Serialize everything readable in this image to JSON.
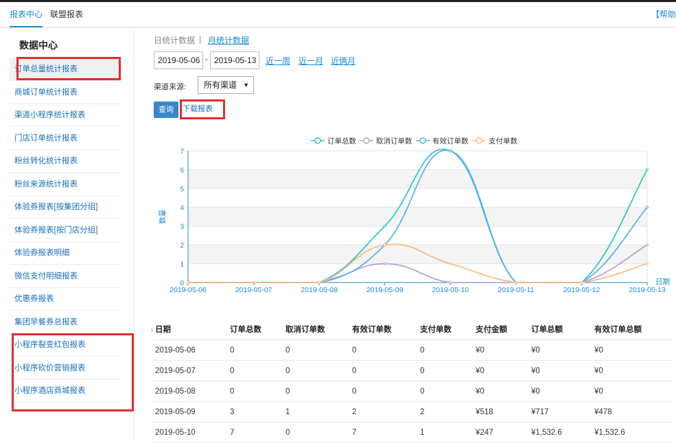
{
  "topnav": {
    "tab1": "报表中心",
    "tab2": "联盟报表",
    "help": "【帮助"
  },
  "sidebar": {
    "title": "数据中心",
    "items": [
      {
        "label": "订单总量统计报表"
      },
      {
        "label": "商城订单统计报表"
      },
      {
        "label": "渠道小程序统计报表"
      },
      {
        "label": "门店订单统计报表"
      },
      {
        "label": "粉丝转化统计报表"
      },
      {
        "label": "粉丝来源统计报表"
      },
      {
        "label": "体验券报表[按集团分组]"
      },
      {
        "label": "体验券报表[按门店分组]"
      },
      {
        "label": "体验券报表明细"
      },
      {
        "label": "微信支付明细报表"
      },
      {
        "label": "优惠券报表"
      },
      {
        "label": "集团早餐券总报表"
      },
      {
        "label": "小程序裂变红包报表"
      },
      {
        "label": "小程序砍价营销报表"
      },
      {
        "label": "小程序酒店商城报表"
      }
    ]
  },
  "filters": {
    "daily_tab": "日统计数据",
    "separator": "|",
    "monthly_tab": "月统计数据",
    "start_date": "2019-05-06",
    "date_dash": "-",
    "end_date": "2019-05-13",
    "quick_week": "近一周",
    "quick_month": "近一月",
    "quick_two_months": "近俩月",
    "channel_label": "渠道来源:",
    "channel_value": "所有渠道",
    "query_button": "查询",
    "download_button": "下载报表"
  },
  "chart_data": {
    "type": "line",
    "categories": [
      "2019-05-06",
      "2019-05-07",
      "2019-05-08",
      "2019-05-09",
      "2019-05-10",
      "2019-05-11",
      "2019-05-12",
      "2019-05-13"
    ],
    "xlabel": "日期",
    "ylabel": "数量",
    "ylim": [
      0,
      7
    ],
    "yticks": [
      "0",
      "1",
      "2",
      "3",
      "4",
      "5",
      "6",
      "7"
    ],
    "legend_position": "top",
    "series": [
      {
        "name": "订单总数",
        "color": "#2ec7c9",
        "values": [
          0,
          0,
          0,
          3,
          7,
          0,
          0,
          6
        ]
      },
      {
        "name": "取消订单数",
        "color": "#b6a2de",
        "values": [
          0,
          0,
          0,
          1,
          0,
          0,
          0,
          2
        ]
      },
      {
        "name": "有效订单数",
        "color": "#5ab1ef",
        "values": [
          0,
          0,
          0,
          2,
          7,
          0,
          0,
          4
        ]
      },
      {
        "name": "支付单数",
        "color": "#ffb980",
        "values": [
          0,
          0,
          0,
          2,
          1,
          0,
          0,
          1
        ]
      }
    ]
  },
  "table": {
    "headers": [
      "日期",
      "订单总数",
      "取消订单数",
      "有效订单数",
      "支付单数",
      "支付金额",
      "订单总额",
      "有效订单总额"
    ],
    "rows": [
      [
        "2019-05-06",
        "0",
        "0",
        "0",
        "0",
        "¥0",
        "¥0",
        "¥0"
      ],
      [
        "2019-05-07",
        "0",
        "0",
        "0",
        "0",
        "¥0",
        "¥0",
        "¥0"
      ],
      [
        "2019-05-08",
        "0",
        "0",
        "0",
        "0",
        "¥0",
        "¥0",
        "¥0"
      ],
      [
        "2019-05-09",
        "3",
        "1",
        "2",
        "2",
        "¥518",
        "¥717",
        "¥478"
      ],
      [
        "2019-05-10",
        "7",
        "0",
        "7",
        "1",
        "¥247",
        "¥1,532.6",
        "¥1,532.6"
      ]
    ]
  }
}
